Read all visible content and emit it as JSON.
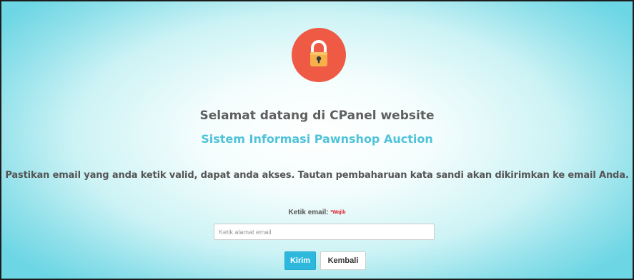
{
  "header": {
    "icon": "lock-icon",
    "welcome": "Selamat datang di CPanel website",
    "system_name": "Sistem Informasi Pawnshop Auction"
  },
  "instruction": "Pastikan email yang anda ketik valid, dapat anda akses. Tautan pembaharuan kata sandi akan dikirimkan ke email Anda.",
  "form": {
    "email_label": "Ketik email:",
    "required_marker": "*Wajib",
    "email_value": "",
    "email_placeholder": "Ketik alamat email",
    "submit_label": "Kirim",
    "back_label": "Kembali"
  },
  "colors": {
    "lock_circle": "#ef5a45",
    "lock_body": "#f7b14a",
    "accent": "#4fc3d9",
    "submit_button": "#2fb8dd",
    "required": "#e0182a"
  }
}
